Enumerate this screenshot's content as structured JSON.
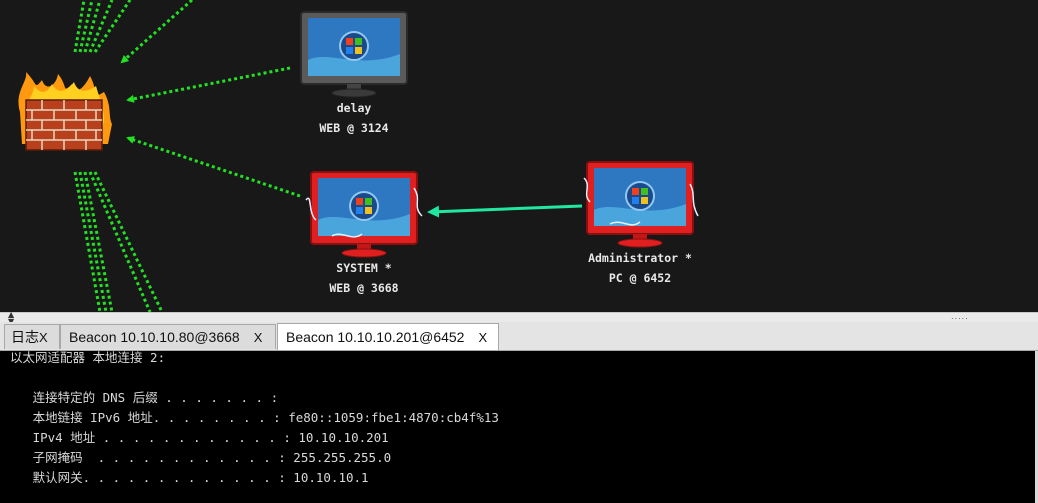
{
  "graph": {
    "nodes": [
      {
        "id": "delay",
        "user": "delay",
        "desc": "WEB @ 3124",
        "state": "normal"
      },
      {
        "id": "system",
        "user": "SYSTEM *",
        "desc": "WEB @ 3668",
        "state": "elevated"
      },
      {
        "id": "admin",
        "user": "Administrator *",
        "desc": "PC @ 6452",
        "state": "elevated"
      }
    ],
    "firewall_icon": "firewall-icon",
    "colors": {
      "pivot_link": "#22e022",
      "session_link": "#20e8a0",
      "elevated": "#e02020",
      "normal": "#707070",
      "background": "#181818"
    }
  },
  "tabs": [
    {
      "label": "日志",
      "close": "X"
    },
    {
      "label": "Beacon 10.10.10.80@3668",
      "close": "X"
    },
    {
      "label": "Beacon 10.10.10.201@6452",
      "close": "X",
      "active": true
    }
  ],
  "console": {
    "lines": [
      "以太网适配器 本地连接 2:",
      "",
      "   连接特定的 DNS 后缀 . . . . . . . :",
      "   本地链接 IPv6 地址. . . . . . . . : fe80::1059:fbe1:4870:cb4f%13",
      "   IPv4 地址 . . . . . . . . . . . . : 10.10.10.201",
      "   子网掩码  . . . . . . . . . . . . : 255.255.255.0",
      "   默认网关. . . . . . . . . . . . . : 10.10.10.1"
    ]
  },
  "splitter": {
    "grip": "....."
  }
}
